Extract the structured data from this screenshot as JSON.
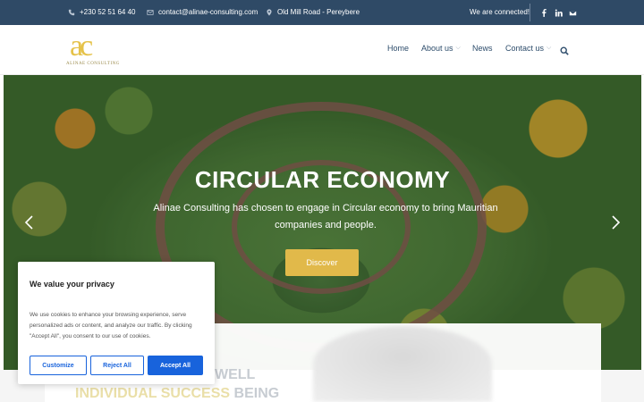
{
  "topbar": {
    "phone": "+230 52 51 64 40",
    "email": "contact@alinae-consulting.com",
    "address": "Old Mill Road - Pereybere",
    "status": "We are connected!",
    "social": [
      "facebook-icon",
      "linkedin-icon",
      "mail-icon"
    ]
  },
  "header": {
    "logo_mark": "ac",
    "logo_name": "ALINAE CONSULTING",
    "nav": {
      "home": "Home",
      "about": "About us",
      "news": "News",
      "contact": "Contact us"
    }
  },
  "hero": {
    "title": "CIRCULAR ECONOMY",
    "text": "Alinae Consulting has chosen to engage in Circular economy to bring Mauritian companies and people.",
    "button": "Discover"
  },
  "section": {
    "line1_grey": "WELL",
    "line2_highlight": "INDIVIDUAL SUCCESS",
    "line2_grey": "BEING"
  },
  "cookie": {
    "title": "We value your privacy",
    "text": "We use cookies to enhance your browsing experience, serve personalized ads or content, and analyze our traffic. By clicking \"Accept All\", you consent to our use of cookies.",
    "customize": "Customize",
    "reject": "Reject All",
    "accept": "Accept All"
  },
  "colors": {
    "topbar": "#2f4a66",
    "nav_text": "#2d4c6b",
    "accent_gold": "#e1b94a",
    "cookie_blue": "#1863dc"
  }
}
